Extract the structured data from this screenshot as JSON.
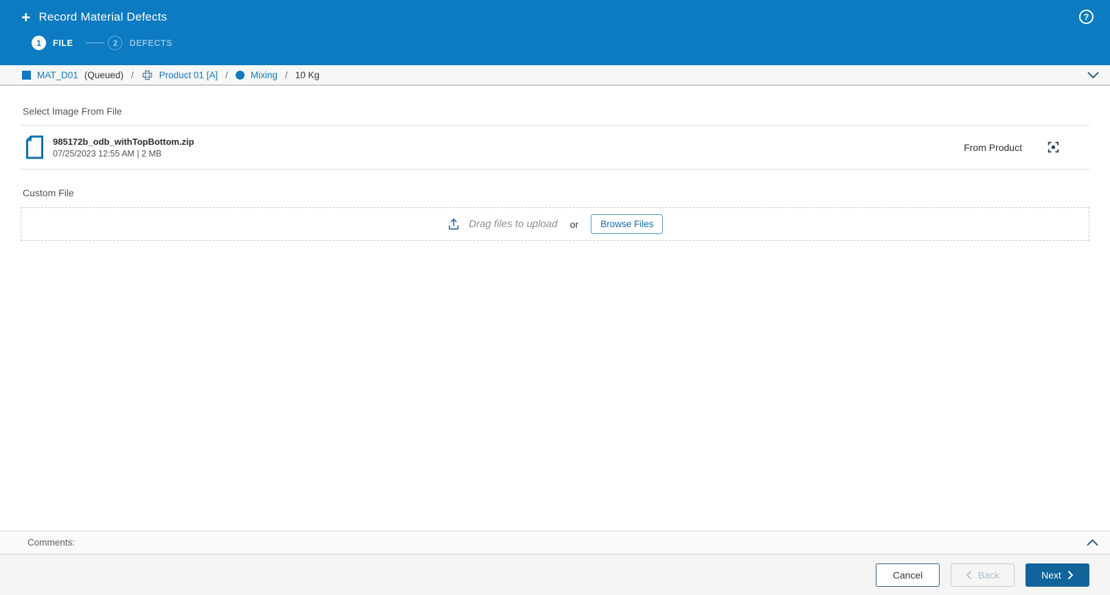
{
  "header": {
    "plus_glyph": "+",
    "title": "Record Material Defects",
    "help_glyph": "?",
    "steps": [
      {
        "number": "1",
        "label": "FILE"
      },
      {
        "number": "2",
        "label": "DEFECTS"
      }
    ]
  },
  "breadcrumb": {
    "material": "MAT_D01",
    "status": "(Queued)",
    "separator": "/",
    "product": "Product 01 [A]",
    "operation": "Mixing",
    "quantity": "10 Kg"
  },
  "file_section": {
    "heading": "Select Image From File",
    "file": {
      "name": "985172b_odb_withTopBottom.zip",
      "meta": "07/25/2023 12:55 AM | 2 MB",
      "source_label": "From Product"
    }
  },
  "custom_file": {
    "heading": "Custom File",
    "drag_label": "Drag files to upload",
    "or_label": "or",
    "browse_label": "Browse Files"
  },
  "comments": {
    "label": "Comments:"
  },
  "footer": {
    "cancel_label": "Cancel",
    "back_label": "Back",
    "next_label": "Next"
  },
  "colors": {
    "header_blue": "#0d7bc1",
    "link_blue": "#0f7ac0",
    "next_blue": "#0f649c",
    "accent_border": "#4f94c5"
  }
}
